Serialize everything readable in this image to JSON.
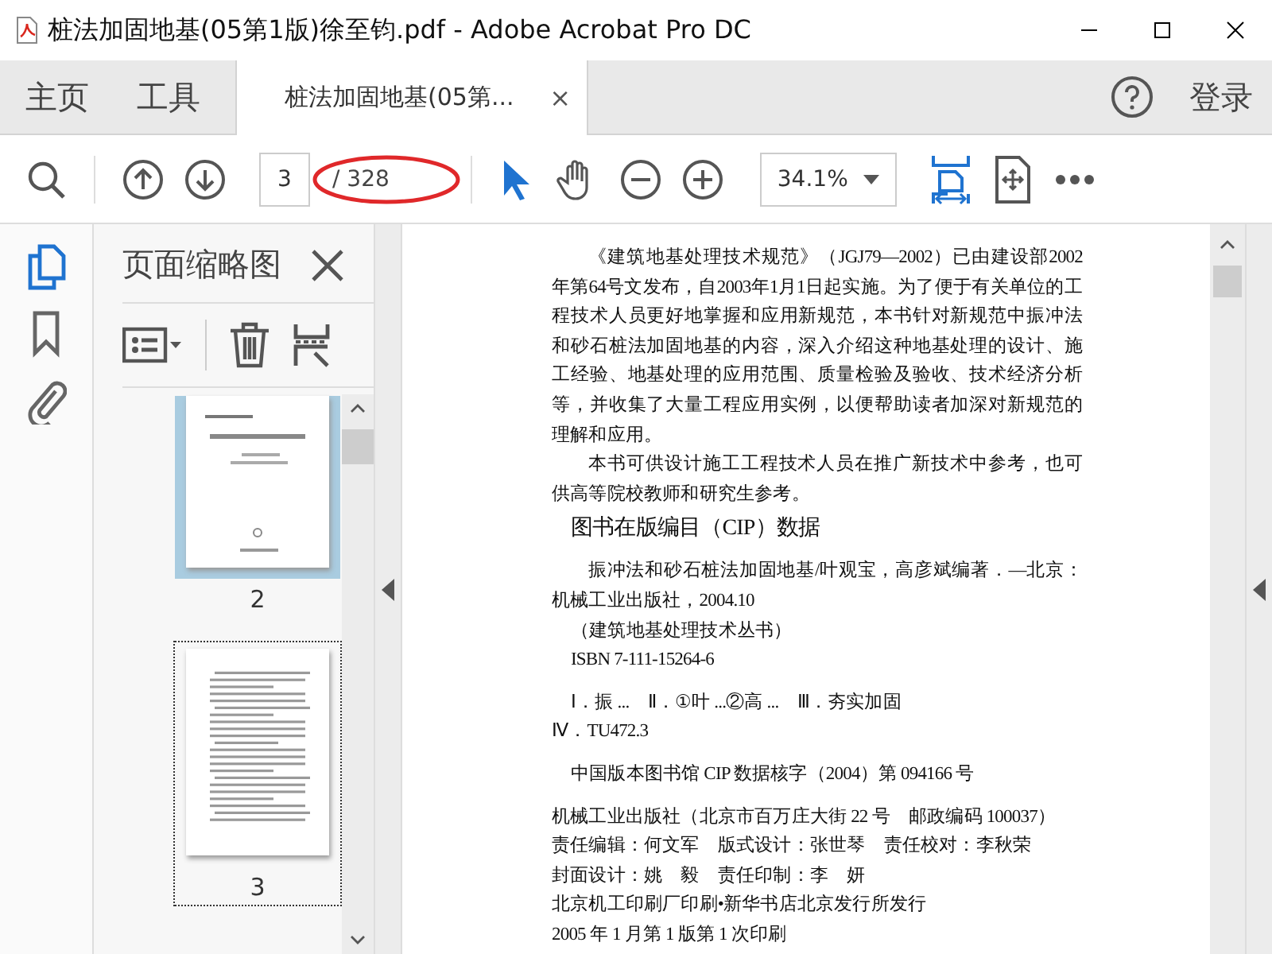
{
  "window": {
    "title": "桩法加固地基(05第1版)徐至钧.pdf - Adobe Acrobat Pro DC"
  },
  "nav_tabs": [
    {
      "label": "主页"
    },
    {
      "label": "工具"
    }
  ],
  "document_tab": {
    "label": "桩法加固地基(05第...",
    "close": "×",
    "selected": true
  },
  "account": {
    "login": "登录"
  },
  "toolbar": {
    "page_number": "3",
    "page_count": "/ 328",
    "zoom": "34.1%"
  },
  "rail": [
    {
      "kind": "pages",
      "selected": true
    },
    {
      "kind": "bookmarks",
      "selected": false
    },
    {
      "kind": "attachments",
      "selected": false
    }
  ],
  "thumbnail_panel": {
    "title": "页面缩略图",
    "thumbnails": [
      {
        "label": "2",
        "kind": "cover",
        "selected": true,
        "focused": false
      },
      {
        "label": "3",
        "kind": "text",
        "selected": false,
        "focused": true
      }
    ]
  },
  "document": {
    "blocks": [
      {
        "kind": "para",
        "text": "《建筑地基处理技术规范》（JGJ79—2002）已由建设部2002年第64号文发布，自2003年1月1日起实施。为了便于有关单位的工程技术人员更好地掌握和应用新规范，本书针对新规范中振冲法和砂石桩法加固地基的内容，深入介绍这种地基处理的设计、施工经验、地基处理的应用范围、质量检验及验收、技术经济分析等，并收集了大量工程应用实例，以便帮助读者加深对新规范的理解和应用。"
      },
      {
        "kind": "para",
        "text": "本书可供设计施工工程技术人员在推广新技术中参考，也可供高等院校教师和研究生参考。"
      },
      {
        "kind": "heading",
        "text": "图书在版编目（CIP）数据"
      },
      {
        "kind": "para",
        "text": "振冲法和砂石桩法加固地基/叶观宝，高彦斌编著．—北京：机械工业出版社，2004.10"
      },
      {
        "kind": "indent",
        "text": "（建筑地基处理技术丛书）"
      },
      {
        "kind": "indent",
        "text": "ISBN 7-111-15264-6"
      },
      {
        "kind": "gap-indent",
        "text": "Ⅰ．振 ...　Ⅱ．①叶 ...②高 ...　Ⅲ．夯实加固"
      },
      {
        "kind": "line",
        "text": "Ⅳ．TU472.3"
      },
      {
        "kind": "gap-indent",
        "text": "中国版本图书馆 CIP 数据核字（2004）第 094166 号"
      },
      {
        "kind": "gap-line",
        "text": "机械工业出版社（北京市百万庄大街 22 号　邮政编码 100037）"
      },
      {
        "kind": "line",
        "text": "责任编辑：何文军　版式设计：张世琴　责任校对：李秋荣"
      },
      {
        "kind": "line",
        "text": "封面设计：姚　毅　责任印制：李　妍"
      },
      {
        "kind": "line",
        "text": "北京机工印刷厂印刷•新华书店北京发行所发行"
      },
      {
        "kind": "line",
        "text": "2005 年 1 月第 1 版第 1 次印刷"
      }
    ]
  }
}
